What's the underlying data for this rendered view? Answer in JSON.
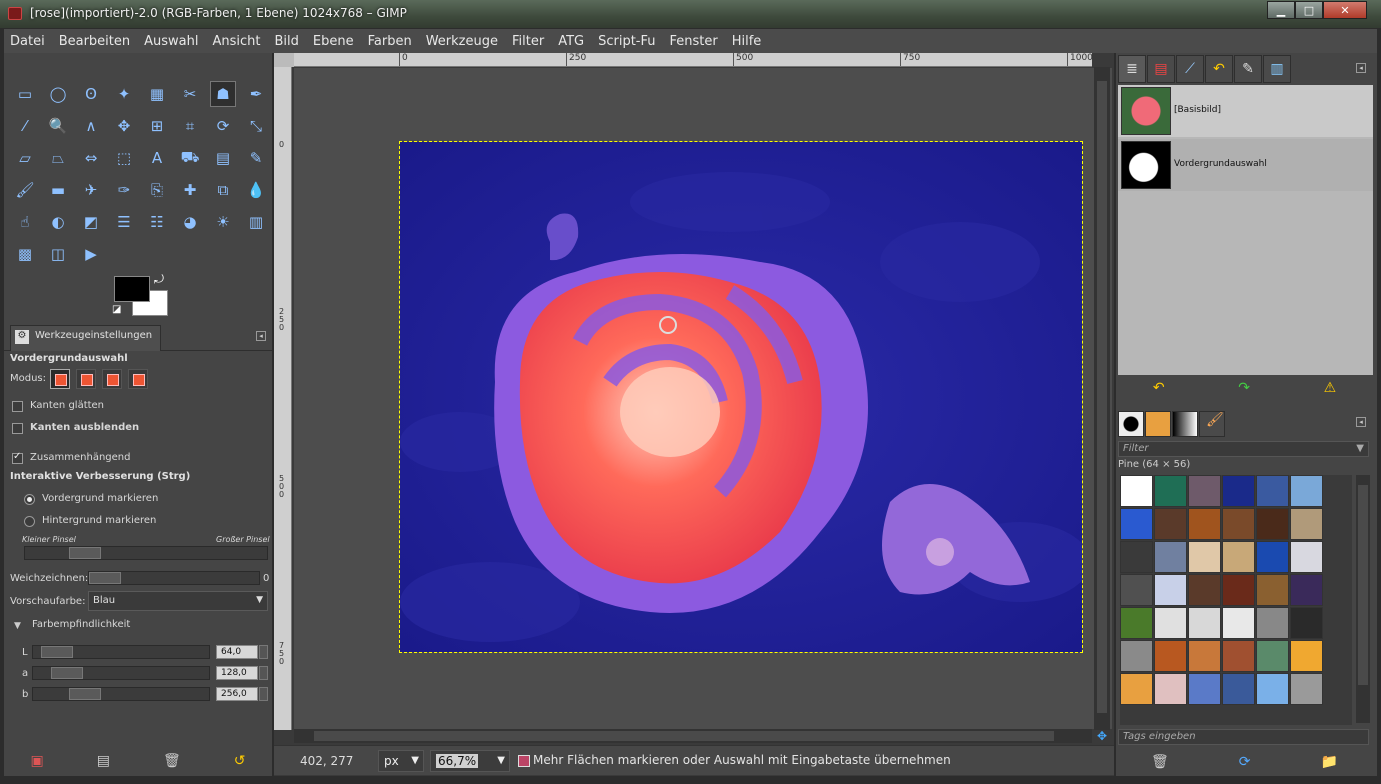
{
  "window": {
    "title": "[rose](importiert)-2.0 (RGB-Farben, 1 Ebene) 1024x768 – GIMP",
    "minimize": "▁",
    "maximize": "□",
    "close": "✕"
  },
  "menubar": [
    "Datei",
    "Bearbeiten",
    "Auswahl",
    "Ansicht",
    "Bild",
    "Ebene",
    "Farben",
    "Werkzeuge",
    "Filter",
    "ATG",
    "Script-Fu",
    "Fenster",
    "Hilfe"
  ],
  "toolbox": {
    "tools": [
      {
        "name": "rect-select-icon",
        "glyph": "▭"
      },
      {
        "name": "ellipse-select-icon",
        "glyph": "◯"
      },
      {
        "name": "free-select-icon",
        "glyph": "ʘ"
      },
      {
        "name": "fuzzy-select-icon",
        "glyph": "✦"
      },
      {
        "name": "select-by-color-icon",
        "glyph": "▦"
      },
      {
        "name": "scissors-icon",
        "glyph": "✂"
      },
      {
        "name": "foreground-select-icon",
        "glyph": "☗",
        "active": true
      },
      {
        "name": "paths-icon",
        "glyph": "✒"
      },
      {
        "name": "color-picker-icon",
        "glyph": "⁄"
      },
      {
        "name": "zoom-icon",
        "glyph": "🔍"
      },
      {
        "name": "measure-icon",
        "glyph": "∧"
      },
      {
        "name": "move-icon",
        "glyph": "✥"
      },
      {
        "name": "align-icon",
        "glyph": "⊞"
      },
      {
        "name": "crop-icon",
        "glyph": "⌗"
      },
      {
        "name": "rotate-icon",
        "glyph": "⟳"
      },
      {
        "name": "scale-icon",
        "glyph": "⤡"
      },
      {
        "name": "shear-icon",
        "glyph": "▱"
      },
      {
        "name": "perspective-icon",
        "glyph": "⏢"
      },
      {
        "name": "flip-icon",
        "glyph": "⇔"
      },
      {
        "name": "cage-icon",
        "glyph": "⬚"
      },
      {
        "name": "text-icon",
        "glyph": "A"
      },
      {
        "name": "bucket-fill-icon",
        "glyph": "⛟"
      },
      {
        "name": "blend-icon",
        "glyph": "▤"
      },
      {
        "name": "pencil-icon",
        "glyph": "✎"
      },
      {
        "name": "paintbrush-icon",
        "glyph": "🖌"
      },
      {
        "name": "eraser-icon",
        "glyph": "▬"
      },
      {
        "name": "airbrush-icon",
        "glyph": "✈"
      },
      {
        "name": "ink-icon",
        "glyph": "✑"
      },
      {
        "name": "clone-icon",
        "glyph": "⎘"
      },
      {
        "name": "heal-icon",
        "glyph": "✚"
      },
      {
        "name": "perspective-clone-icon",
        "glyph": "⧉"
      },
      {
        "name": "blur-icon",
        "glyph": "💧"
      },
      {
        "name": "smudge-icon",
        "glyph": "☝"
      },
      {
        "name": "dodge-burn-icon",
        "glyph": "◐"
      },
      {
        "name": "desaturate-icon",
        "glyph": "◩"
      },
      {
        "name": "levels-icon",
        "glyph": "☰"
      },
      {
        "name": "curves-icon",
        "glyph": "☷"
      },
      {
        "name": "hue-saturation-icon",
        "glyph": "◕"
      },
      {
        "name": "brightness-contrast-icon",
        "glyph": "☀"
      },
      {
        "name": "histogram-icon",
        "glyph": "▥"
      },
      {
        "name": "threshold-icon",
        "glyph": "▩"
      },
      {
        "name": "color-balance-icon",
        "glyph": "◫"
      },
      {
        "name": "gradient-map-icon",
        "glyph": "▶"
      }
    ],
    "colors": {
      "fg": "#000000",
      "bg": "#ffffff",
      "swap": "⤾",
      "reset": "◪"
    },
    "tab_label": "Werkzeugeinstellungen",
    "options": {
      "title": "Vordergrundauswahl",
      "mode_label": "Modus:",
      "antialias": "Kanten glätten",
      "feather": "Kanten ausblenden",
      "contiguous": "Zusammenhängend",
      "refinement": "Interaktive Verbesserung (Strg)",
      "mark_fg": "Vordergrund markieren",
      "mark_bg": "Hintergrund markieren",
      "small_brush": "Kleiner Pinsel",
      "large_brush": "Großer Pinsel",
      "smoothing_label": "Weichzeichnen:",
      "smoothing_value": "0",
      "preview_label": "Vorschaufarbe:",
      "preview_value": "Blau",
      "sensitivity": "Farbempfindlichkeit",
      "L_label": "L",
      "L_value": "64,0",
      "a_label": "a",
      "a_value": "128,0",
      "b_label": "b",
      "b_value": "256,0"
    },
    "bottom_icons": [
      "save-preset-icon",
      "restore-preset-icon",
      "delete-preset-icon",
      "reset-preset-icon"
    ]
  },
  "canvas": {
    "hruler": [
      "0",
      "250",
      "500",
      "750",
      "1000"
    ],
    "vruler": [
      "0",
      "250",
      "500",
      "750"
    ]
  },
  "statusbar": {
    "coords": "402, 277",
    "unit": "px",
    "zoom": "66,7%",
    "message": "Mehr Flächen markieren oder Auswahl mit Eingabetaste übernehmen"
  },
  "rightpanel": {
    "layers": [
      {
        "name": "[Basisbild]"
      },
      {
        "name": "Vordergrundauswahl"
      }
    ],
    "patterns": {
      "filter_placeholder": "Filter",
      "info": "Pine (64 × 56)",
      "tags_placeholder": "Tags eingeben",
      "swatches": [
        "#ffffff",
        "#1f6e55",
        "#6e5a6a",
        "#1a2a8a",
        "#3a5aa0",
        "#7aa8d8",
        "#2a5ad0",
        "#5a3a2a",
        "#a0541e",
        "#7a4a2a",
        "#4a2a1a",
        "#b09a7a",
        "#3a3a3a",
        "#7080a0",
        "#e0c8a8",
        "#c8a878",
        "#1a4ab0",
        "#d8d8e0",
        "#505050",
        "#c8d0e8",
        "#5a3a2a",
        "#6a2a1a",
        "#8a6030",
        "#3a2a5a",
        "#4a7a2a",
        "#e0e0e0",
        "#d8d8d8",
        "#e8e8e8",
        "#888888",
        "#2a2a2a",
        "#8a8a8a",
        "#b85820",
        "#c8783a",
        "#a05030",
        "#5a8a6a",
        "#f0a830",
        "#e8a040",
        "#e0c0c0",
        "#5a7ac8",
        "#3a5a9a",
        "#7ab0e8",
        "#9a9a9a"
      ]
    },
    "bottom_icons": [
      "delete-pattern-icon",
      "refresh-patterns-icon",
      "open-folder-icon"
    ]
  }
}
